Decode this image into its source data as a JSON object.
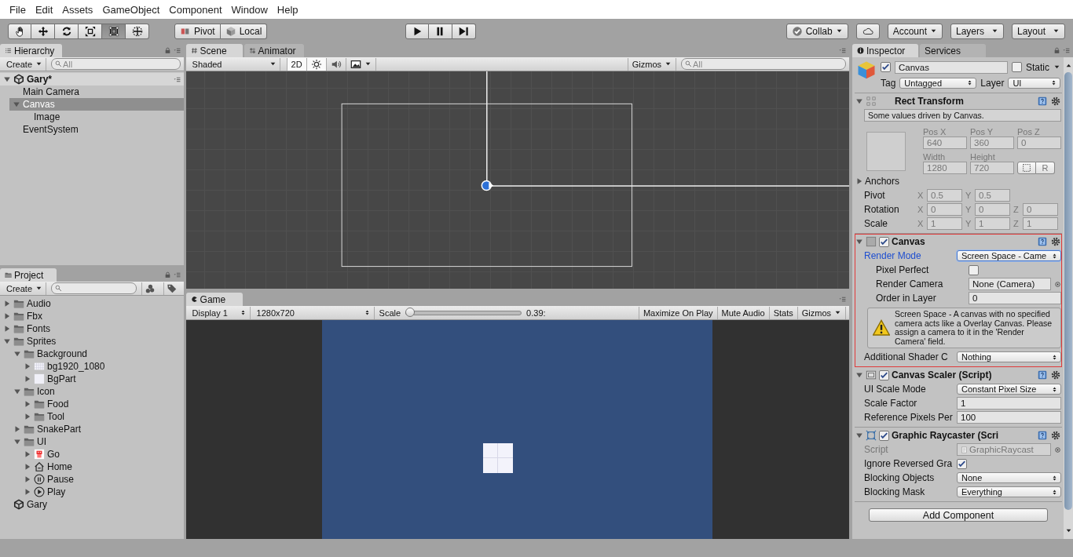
{
  "menu": [
    "File",
    "Edit",
    "Assets",
    "GameObject",
    "Component",
    "Window",
    "Help"
  ],
  "toolbar": {
    "transform_tools": [
      {
        "kind": "hand",
        "selected": false
      },
      {
        "kind": "move",
        "selected": false
      },
      {
        "kind": "rotate",
        "selected": false
      },
      {
        "kind": "scale",
        "selected": false
      },
      {
        "kind": "rect",
        "selected": true
      },
      {
        "kind": "transform",
        "selected": false
      }
    ],
    "pivot": "Pivot",
    "local": "Local",
    "play_controls": [
      {
        "kind": "play"
      },
      {
        "kind": "pause"
      },
      {
        "kind": "step"
      }
    ],
    "collab": "Collab",
    "account": "Account",
    "layers": "Layers",
    "layout": "Layout"
  },
  "hierarchy": {
    "tab": "Hierarchy",
    "create": "Create",
    "search_placeholder": "All",
    "scene": {
      "name": "Gary*",
      "expanded": true,
      "children": [
        {
          "name": "Main Camera",
          "selected": false
        },
        {
          "name": "Canvas",
          "selected": true,
          "expanded": true,
          "children": [
            {
              "name": "Image",
              "selected": false
            }
          ]
        },
        {
          "name": "EventSystem",
          "selected": false
        }
      ]
    }
  },
  "project": {
    "tab": "Project",
    "create": "Create",
    "tree": [
      {
        "name": "Audio",
        "kind": "folder",
        "expanded": false
      },
      {
        "name": "Fbx",
        "kind": "folder",
        "expanded": false
      },
      {
        "name": "Fonts",
        "kind": "folder",
        "expanded": false
      },
      {
        "name": "Sprites",
        "kind": "folder",
        "expanded": true,
        "children": [
          {
            "name": "Background",
            "kind": "folder",
            "expanded": true,
            "children": [
              {
                "name": "bg1920_1080",
                "kind": "texture",
                "expanded": false
              },
              {
                "name": "BgPart",
                "kind": "sprite",
                "expanded": false
              }
            ]
          },
          {
            "name": "Icon",
            "kind": "folder",
            "expanded": true,
            "children": [
              {
                "name": "Food",
                "kind": "folder",
                "expanded": false
              },
              {
                "name": "Tool",
                "kind": "folder",
                "expanded": false
              }
            ]
          },
          {
            "name": "SnakePart",
            "kind": "folder",
            "expanded": false
          },
          {
            "name": "UI",
            "kind": "folder",
            "expanded": true,
            "children": [
              {
                "name": "Go",
                "kind": "character",
                "expanded": false
              },
              {
                "name": "Home",
                "kind": "home",
                "expanded": false
              },
              {
                "name": "Pause",
                "kind": "pause",
                "expanded": false
              },
              {
                "name": "Play",
                "kind": "play",
                "expanded": false
              }
            ]
          }
        ]
      },
      {
        "name": "Gary",
        "kind": "scene"
      }
    ]
  },
  "scene_view": {
    "tabs": [
      {
        "label": "Scene",
        "kind": "scene",
        "selected": true
      },
      {
        "label": "Animator",
        "kind": "animator",
        "selected": false
      }
    ],
    "shading": "Shaded",
    "mode_2d": {
      "label": "2D",
      "on": true
    },
    "lighting_on": true,
    "audio_on": false,
    "gizmos": "Gizmos",
    "search_placeholder": "All"
  },
  "game_view": {
    "tab": "Game",
    "display": "Display 1",
    "resolution": "1280x720",
    "scale_label": "Scale",
    "scale": {
      "level": 0
    },
    "scale_value": "0.39:",
    "buttons": [
      {
        "label": "Maximize On Play",
        "kind": "toggle"
      },
      {
        "label": "Mute Audio",
        "kind": "toggle"
      },
      {
        "label": "Stats",
        "kind": "toggle"
      },
      {
        "label": "Gizmos",
        "kind": "dropdown"
      }
    ]
  },
  "inspector": {
    "tabs": [
      {
        "label": "Inspector",
        "selected": true
      },
      {
        "label": "Services",
        "selected": false
      }
    ],
    "object": {
      "active": true,
      "name": "Canvas",
      "static": false,
      "static_label": "Static",
      "tag_label": "Tag",
      "tag": "Untagged",
      "layer_label": "Layer",
      "layer": "UI"
    },
    "components": [
      {
        "kind": "rect_transform",
        "title": "Rect Transform",
        "expanded": true,
        "note": "Some values driven by Canvas.",
        "position": [
          {
            "label": "Pos X",
            "value": "640"
          },
          {
            "label": "Pos Y",
            "value": "360"
          },
          {
            "label": "Pos Z",
            "value": "0"
          }
        ],
        "size": [
          {
            "label": "Width",
            "value": "1280"
          },
          {
            "label": "Height",
            "value": "720"
          }
        ],
        "raw_button": "R",
        "anchors": {
          "label": "Anchors",
          "expanded": false
        },
        "vectors": [
          {
            "label": "Pivot",
            "axes": [
              {
                "axis": "X",
                "value": "0.5"
              },
              {
                "axis": "Y",
                "value": "0.5"
              }
            ]
          },
          {
            "label": "Rotation",
            "axes": [
              {
                "axis": "X",
                "value": "0"
              },
              {
                "axis": "Y",
                "value": "0"
              },
              {
                "axis": "Z",
                "value": "0"
              }
            ]
          },
          {
            "label": "Scale",
            "axes": [
              {
                "axis": "X",
                "value": "1"
              },
              {
                "axis": "Y",
                "value": "1"
              },
              {
                "axis": "Z",
                "value": "1"
              }
            ]
          }
        ]
      },
      {
        "kind": "canvas",
        "title": "Canvas",
        "expanded": true,
        "enabled": true,
        "highlighted": true,
        "properties": [
          {
            "kind": "dropdown",
            "label": "Render Mode",
            "value": "Screen Space - Came",
            "modified": true,
            "focused": true,
            "children": [
              {
                "kind": "checkbox",
                "label": "Pixel Perfect",
                "checked": false
              },
              {
                "kind": "object",
                "label": "Render Camera",
                "value": "None (Camera)"
              },
              {
                "kind": "field",
                "label": "Order in Layer",
                "value": "0"
              },
              {
                "kind": "warning",
                "text": "Screen Space - A canvas with no specified camera acts like a Overlay Canvas. Please assign a camera to it in the 'Render Camera' field."
              }
            ]
          },
          {
            "kind": "dropdown",
            "label": "Additional Shader C",
            "value": "Nothing"
          }
        ]
      },
      {
        "kind": "canvas_scaler",
        "title": "Canvas Scaler (Script)",
        "expanded": true,
        "enabled": true,
        "highlighted": false,
        "properties": [
          {
            "kind": "dropdown",
            "label": "UI Scale Mode",
            "value": "Constant Pixel Size"
          },
          {
            "kind": "field",
            "label": "Scale Factor",
            "value": "1"
          },
          {
            "kind": "field",
            "label": "Reference Pixels Per",
            "value": "100"
          }
        ]
      },
      {
        "kind": "graphic_raycaster",
        "title": "Graphic Raycaster (Scri",
        "expanded": true,
        "enabled": true,
        "highlighted": false,
        "properties": [
          {
            "kind": "object",
            "label": "Script",
            "value": "GraphicRaycast",
            "disabled": true
          },
          {
            "kind": "checkbox",
            "label": "Ignore Reversed Gra",
            "checked": true
          },
          {
            "kind": "dropdown",
            "label": "Blocking Objects",
            "value": "None"
          },
          {
            "kind": "dropdown",
            "label": "Blocking Mask",
            "value": "Everything"
          }
        ]
      }
    ],
    "add_component": "Add Component"
  }
}
